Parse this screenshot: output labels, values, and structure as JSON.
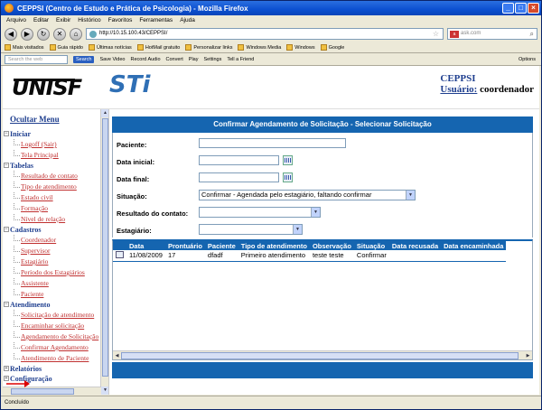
{
  "window": {
    "title": "CEPPSI (Centro de Estudo e Prática de Psicologia) - Mozilla Firefox"
  },
  "menubar": [
    "Arquivo",
    "Editar",
    "Exibir",
    "Histórico",
    "Favoritos",
    "Ferramentas",
    "Ajuda"
  ],
  "navbar": {
    "url": "http://10.15.100.43/CEPPSI/",
    "search_placeholder": "ask.com"
  },
  "bookmarks": [
    "Mais visitados",
    "Guia rápido",
    "Últimas notícias",
    "HotMail gratuito",
    "Personalizar links",
    "Windows Media",
    "Windows",
    "Google"
  ],
  "toolbar2": {
    "search_placeholder": "Search the web",
    "search_button": "Search",
    "items": [
      "Save Video",
      "Record Audio",
      "Convert",
      "Play",
      "Settings",
      "Tell a Friend"
    ],
    "options": "Options"
  },
  "header": {
    "logo_left": "UNISF",
    "logo_right": "STi",
    "org": "CEPPSI",
    "user_label": "Usuário:",
    "user_name": "coordenador"
  },
  "sidebar": {
    "title": "Ocultar Menu",
    "groups": [
      {
        "label": "Iniciar",
        "toggle": "−",
        "items": [
          "Logoff (Sair)",
          "Tela Principal"
        ]
      },
      {
        "label": "Tabelas",
        "toggle": "−",
        "items": [
          "Resultado de contato",
          "Tipo de atendimento",
          "Estado civil",
          "Formação",
          "Nível de relação"
        ]
      },
      {
        "label": "Cadastros",
        "toggle": "−",
        "items": [
          "Coordenador",
          "Supervisor",
          "Estagiário",
          "Período dos Estagiários",
          "Assistente",
          "Paciente"
        ]
      },
      {
        "label": "Atendimento",
        "toggle": "−",
        "items": [
          "Solicitação de atendimento",
          "Encaminhar solicitação",
          "Agendamento de Solicitação",
          "Confirmar Agendamento",
          "Atendimento de Paciente"
        ]
      },
      {
        "label": "Relatórios",
        "toggle": "+",
        "items": []
      },
      {
        "label": "Configuração",
        "toggle": "+",
        "items": []
      }
    ]
  },
  "panel": {
    "title": "Confirmar Agendamento de Solicitação - Selecionar Solicitação",
    "fields": {
      "paciente_label": "Paciente:",
      "data_inicial_label": "Data inicial:",
      "data_final_label": "Data final:",
      "situacao_label": "Situação:",
      "situacao_value": "Confirmar - Agendada pelo estagiário, faltando confirmar",
      "resultado_label": "Resultado do contato:",
      "estagiario_label": "Estagiário:"
    },
    "table": {
      "columns": [
        "Data",
        "Prontuário",
        "Paciente",
        "Tipo de atendimento",
        "Observação",
        "Situação",
        "Data recusada",
        "Data encaminhada"
      ],
      "rows": [
        [
          "11/08/2009",
          "17",
          "dfadf",
          "Primeiro atendimento",
          "teste teste",
          "Confirmar",
          "",
          ""
        ]
      ]
    }
  },
  "status": "Concluído"
}
